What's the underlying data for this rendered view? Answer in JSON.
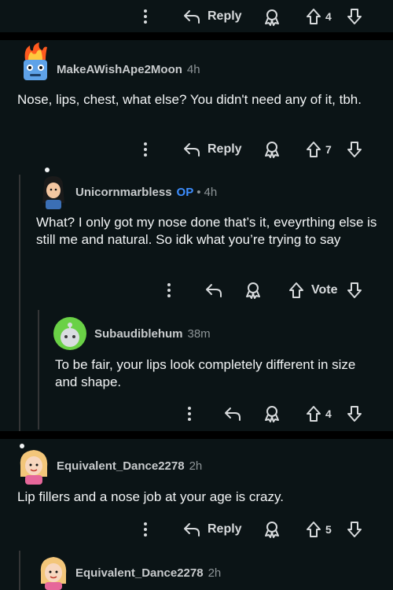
{
  "row0": {
    "reply_label": "Reply",
    "votes": "4"
  },
  "c1": {
    "username": "MakeAWishApe2Moon",
    "time": "4h",
    "text": "Nose, lips, chest, what else? You didn't need any of it, tbh.",
    "reply_label": "Reply",
    "votes": "7"
  },
  "c2": {
    "username": "Unicornmarbless",
    "op_label": "OP",
    "time": "4h",
    "text": "What? I only got my nose done that’s it, eveyrthing else is still me and natural. So idk what you’re trying to say",
    "vote_label": "Vote"
  },
  "c3": {
    "username": "Subaudiblehum",
    "time": "38m",
    "text": "To be fair, your lips look completely different in size and shape.",
    "votes": "4"
  },
  "c4": {
    "username": "Equivalent_Dance2278",
    "time": "2h",
    "text": "Lip fillers and a nose job at your age is crazy.",
    "reply_label": "Reply",
    "votes": "5"
  },
  "c5": {
    "username": "Equivalent_Dance2278",
    "time": "2h"
  },
  "icons": [
    "more-icon",
    "reply-icon",
    "award-icon",
    "upvote-icon",
    "downvote-icon",
    "bullet-icon"
  ]
}
